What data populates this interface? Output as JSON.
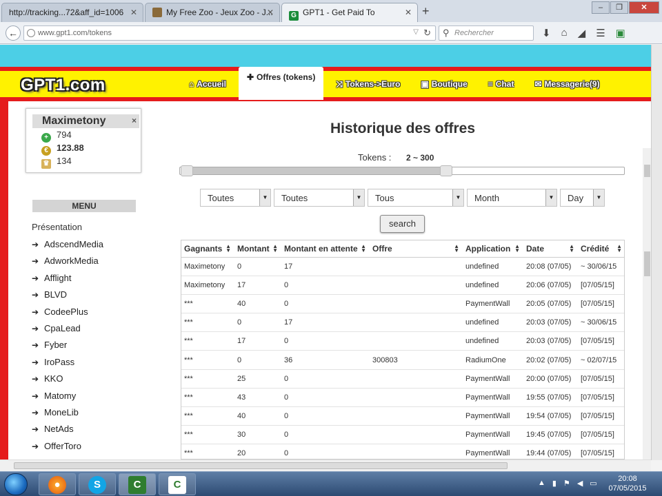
{
  "browser": {
    "tabs": [
      {
        "title": "http://tracking...72&aff_id=1006",
        "active": false
      },
      {
        "title": "My Free Zoo - Jeux Zoo - J...",
        "active": false
      },
      {
        "title": "GPT1 - Get Paid To",
        "active": true
      }
    ],
    "url": "www.gpt1.com/tokens",
    "search_placeholder": "Rechercher"
  },
  "site": {
    "logo": "GPT1.com",
    "nav": [
      {
        "label": "Accueil",
        "icon": "home-icon",
        "glyph": "⌂",
        "active": false
      },
      {
        "label": "Offres (tokens)",
        "icon": "plus-icon",
        "glyph": "✚",
        "active": true
      },
      {
        "label": "Tokens->Euro",
        "icon": "shuffle-icon",
        "glyph": "⤨",
        "active": false
      },
      {
        "label": "Boutique",
        "icon": "cart-icon",
        "glyph": "▣",
        "active": false
      },
      {
        "label": "Chat",
        "icon": "chat-icon",
        "glyph": "≡",
        "active": false
      },
      {
        "label": "Messagerie(9)",
        "icon": "mail-icon",
        "glyph": "✉",
        "active": false
      }
    ]
  },
  "user": {
    "name": "Maximetony",
    "close": "×",
    "points": "794",
    "tokens": "123.88",
    "rank": "134"
  },
  "menu": {
    "title": "MENU",
    "presentation": "Présentation",
    "items": [
      "AdscendMedia",
      "AdworkMedia",
      "Afflight",
      "BLVD",
      "CodeePlus",
      "CpaLead",
      "Fyber",
      "IroPass",
      "KKO",
      "Matomy",
      "MoneLib",
      "NetAds",
      "OfferToro"
    ]
  },
  "main": {
    "title": "Historique des offres",
    "tokens_label": "Tokens :",
    "tokens_range": "2 ~ 300",
    "slider": {
      "min": 2,
      "max": 300,
      "scale_max": 500
    },
    "filters": [
      "Toutes",
      "Toutes",
      "Tous",
      "Month",
      "Day"
    ],
    "search_label": "search"
  },
  "table": {
    "headers": [
      "Gagnants",
      "Montant",
      "Montant en attente",
      "Offre",
      "Application",
      "Date",
      "Crédité"
    ],
    "rows": [
      [
        "Maximetony",
        "0",
        "17",
        "",
        "undefined",
        "20:08 (07/05)",
        "~ 30/06/15"
      ],
      [
        "Maximetony",
        "17",
        "0",
        "",
        "undefined",
        "20:06 (07/05)",
        "[07/05/15]"
      ],
      [
        "***",
        "40",
        "0",
        "",
        "PaymentWall",
        "20:05 (07/05)",
        "[07/05/15]"
      ],
      [
        "***",
        "0",
        "17",
        "",
        "undefined",
        "20:03 (07/05)",
        "~ 30/06/15"
      ],
      [
        "***",
        "17",
        "0",
        "",
        "undefined",
        "20:03 (07/05)",
        "[07/05/15]"
      ],
      [
        "***",
        "0",
        "36",
        "300803",
        "RadiumOne",
        "20:02 (07/05)",
        "~ 02/07/15"
      ],
      [
        "***",
        "25",
        "0",
        "",
        "PaymentWall",
        "20:00 (07/05)",
        "[07/05/15]"
      ],
      [
        "***",
        "43",
        "0",
        "",
        "PaymentWall",
        "19:55 (07/05)",
        "[07/05/15]"
      ],
      [
        "***",
        "40",
        "0",
        "",
        "PaymentWall",
        "19:54 (07/05)",
        "[07/05/15]"
      ],
      [
        "***",
        "30",
        "0",
        "",
        "PaymentWall",
        "19:45 (07/05)",
        "[07/05/15]"
      ],
      [
        "***",
        "20",
        "0",
        "",
        "PaymentWall",
        "19:44 (07/05)",
        "[07/05/15]"
      ]
    ]
  },
  "taskbar": {
    "clock_time": "20:08",
    "clock_date": "07/05/2015"
  },
  "colors": {
    "header_yellow": "#fff200",
    "header_red": "#e51c1c",
    "banner_cyan": "#4ccfe6"
  }
}
